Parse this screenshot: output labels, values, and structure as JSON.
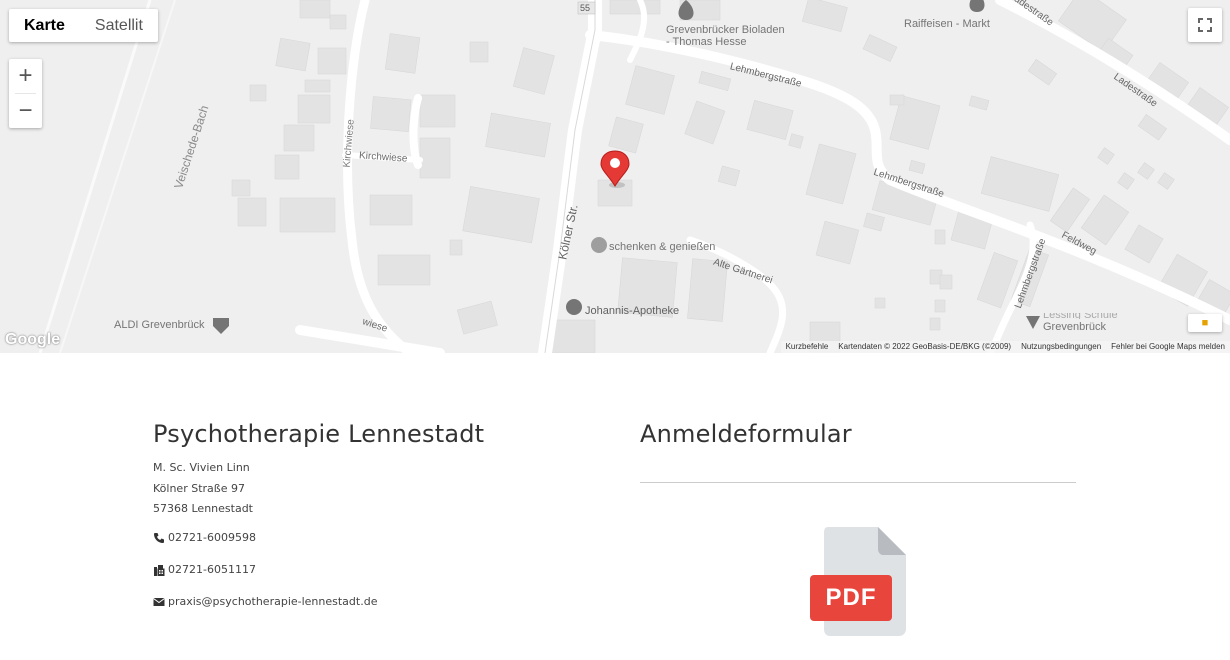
{
  "map": {
    "type_control": {
      "map_label": "Karte",
      "satellite_label": "Satellit",
      "selected": "Karte"
    },
    "zoom": {
      "in": "+",
      "out": "−"
    },
    "labels": {
      "road_55": "55",
      "veischede": "Veischede-Bach",
      "kirchwiese_v": "Kirchwiese",
      "kirchwiese_h": "Kirchwiese",
      "wiese": "wiese",
      "koelner": "Kölner Str.",
      "lehmberg1": "Lehmbergstraße",
      "lehmberg2": "Lehmbergstraße",
      "lehmberg3": "Lehmbergstraße",
      "ladestrasse1": "Ladestraße",
      "ladestrasse2": "Ladestraße",
      "feldweg": "Feldweg",
      "alte_gaertnerei": "Alte Gärtnerei",
      "bioladen_1": "Grevenbrücker Bioladen",
      "bioladen_2": "- Thomas Hesse",
      "raiffeisen": "Raiffeisen - Markt",
      "schenken": "schenken & genießen",
      "apotheke": "Johannis-Apotheke",
      "aldi": "ALDI Grevenbrück",
      "grevenbrueck_1": "Lessing Schule",
      "grevenbrueck_2": "Grevenbrück"
    },
    "google_logo": "Google",
    "attribution": {
      "shortcuts": "Kurzbefehle",
      "data": "Kartendaten © 2022 GeoBasis-DE/BKG (©2009)",
      "terms": "Nutzungsbedingungen",
      "report": "Fehler bei Google Maps melden"
    },
    "colors": {
      "marker": "#e53935",
      "poi": "#757575",
      "road": "#ffffff",
      "building": "#e2e2e2"
    }
  },
  "contact": {
    "title": "Psychotherapie Lennestadt",
    "name": "M. Sc. Vivien Linn",
    "street": "Kölner Straße 97",
    "city": "57368 Lennestadt",
    "phone": "02721-6009598",
    "fax": "02721-6051117",
    "email": "praxis@psychotherapie-lennestadt.de",
    "icons": {
      "phone": "phone-icon",
      "fax": "fax-icon",
      "email": "envelope-icon"
    }
  },
  "form": {
    "title": "Anmeldeformular",
    "pdf_label": "PDF",
    "colors": {
      "pdf_red": "#e8453c"
    }
  }
}
